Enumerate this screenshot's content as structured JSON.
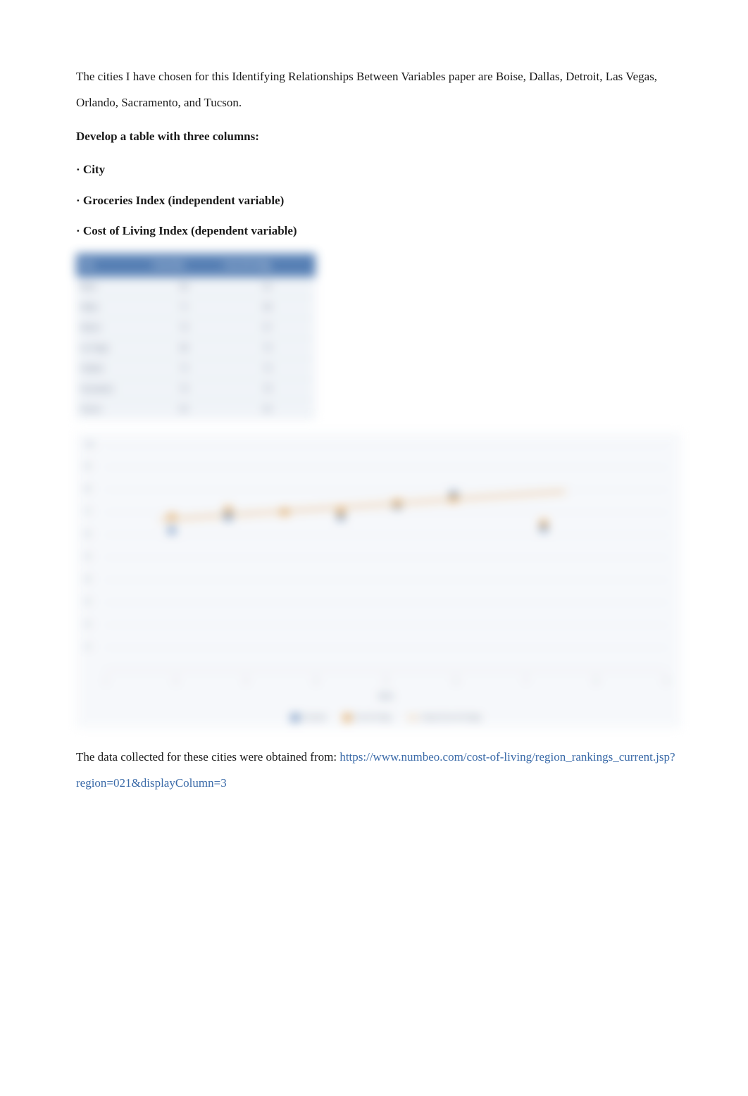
{
  "intro": "The cities I have chosen for this Identifying Relationships Between Variables paper are Boise, Dallas, Detroit, Las Vegas, Orlando, Sacramento, and Tucson.",
  "heading": "Develop a table with three columns:",
  "bullets": {
    "b1": "· City",
    "b2": "· Groceries Index (independent variable)",
    "b3": "· Cost of Living Index (dependent variable)"
  },
  "table": {
    "headers": {
      "c1": "City",
      "c2": "Groceries",
      "c3": "Cost of Living"
    },
    "rows": [
      {
        "city": "Boise",
        "groceries": "68",
        "col": "62"
      },
      {
        "city": "Dallas",
        "groceries": "71",
        "col": "68"
      },
      {
        "city": "Detroit",
        "groceries": "70",
        "col": "67"
      },
      {
        "city": "Las Vegas",
        "groceries": "68",
        "col": "70"
      },
      {
        "city": "Orlando",
        "groceries": "73",
        "col": "74"
      },
      {
        "city": "Sacramento",
        "groceries": "76",
        "col": "78"
      },
      {
        "city": "Tucson",
        "groceries": "65",
        "col": "63"
      }
    ]
  },
  "chart_data": {
    "type": "scatter",
    "title": "",
    "xlabel": "Index",
    "ylabel": "Value",
    "ylim": [
      0,
      100
    ],
    "xticks": [
      "1",
      "2",
      "3",
      "4",
      "5",
      "6",
      "7",
      "8",
      "9"
    ],
    "series": [
      {
        "name": "Groceries",
        "values": [
          62,
          68,
          70,
          68,
          73,
          78,
          63
        ]
      },
      {
        "name": "Cost of Living",
        "values": [
          68,
          71,
          70,
          68,
          73,
          76,
          65
        ]
      }
    ],
    "legend": {
      "a": "Groceries",
      "b": "Cost of Living",
      "c": "Linear (Cost of Living)"
    }
  },
  "footer": {
    "pre": "The data collected for these cities were obtained from: ",
    "link": "https://www.numbeo.com/cost-of-living/region_rankings_current.jsp?region=021&displayColumn=3"
  }
}
